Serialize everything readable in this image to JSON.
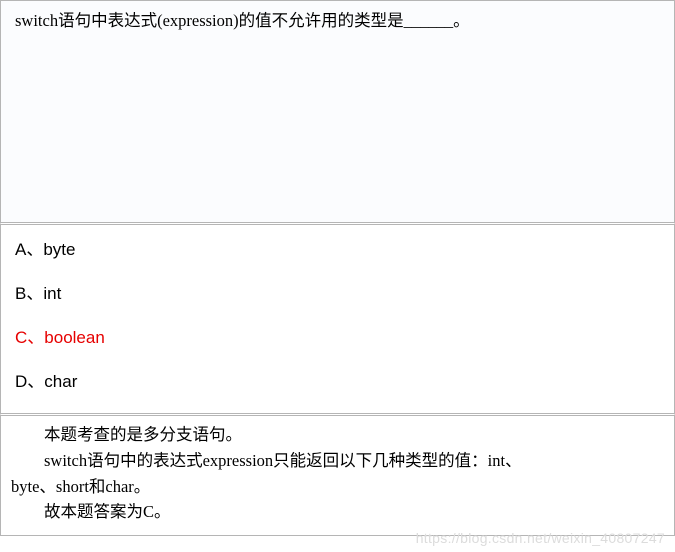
{
  "question": {
    "text": "switch语句中表达式(expression)的值不允许用的类型是______。"
  },
  "options": [
    {
      "label": "A",
      "sep": "、",
      "text": "byte",
      "correct": false
    },
    {
      "label": "B",
      "sep": "、",
      "text": "int",
      "correct": false
    },
    {
      "label": "C",
      "sep": "、",
      "text": "boolean",
      "correct": true
    },
    {
      "label": "D",
      "sep": "、",
      "text": "char",
      "correct": false
    }
  ],
  "explanation": {
    "line1": "本题考查的是多分支语句。",
    "line2a": "switch语句中的表达式expression只能返回以下几种类型的值：int、",
    "line2b": "byte、short和char。",
    "line3": "故本题答案为C。"
  },
  "watermark": "https://blog.csdn.net/weixin_40807247"
}
